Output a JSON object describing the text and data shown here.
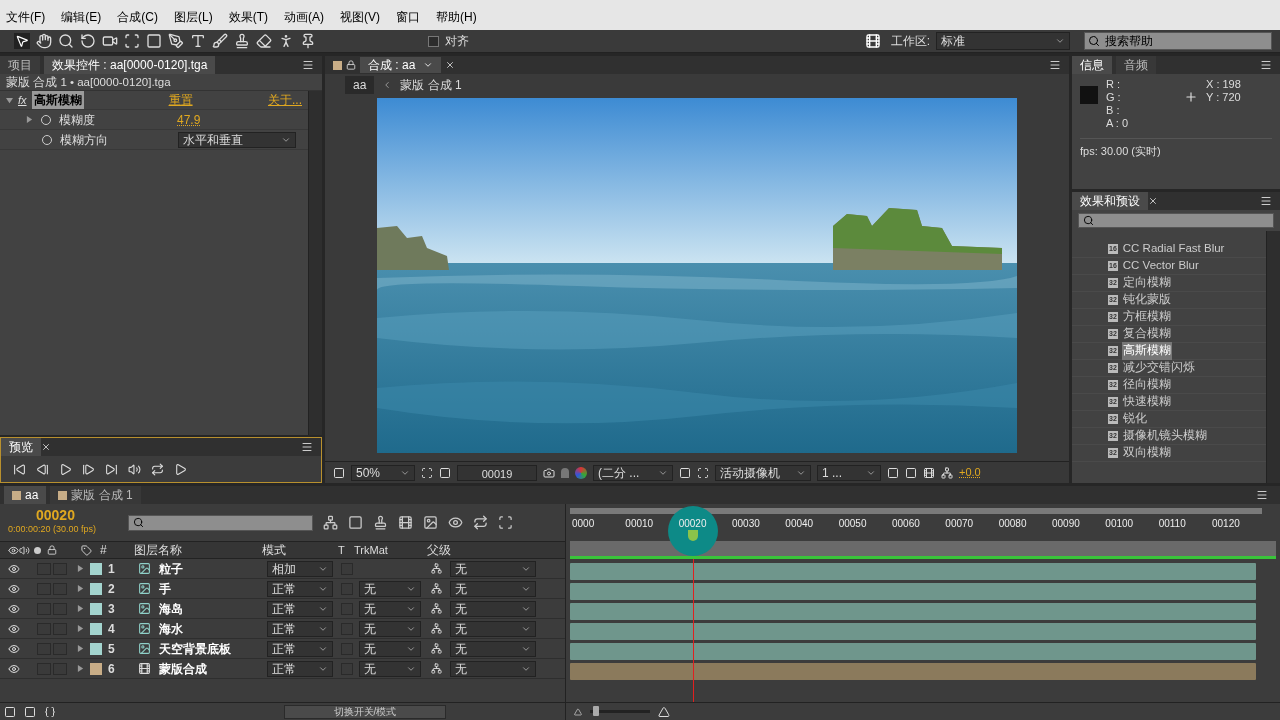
{
  "menu": [
    "文件(F)",
    "编辑(E)",
    "合成(C)",
    "图层(L)",
    "效果(T)",
    "动画(A)",
    "视图(V)",
    "窗口",
    "帮助(H)"
  ],
  "toolbar": {
    "align_label": "对齐",
    "align_checked": false,
    "workspace_label": "工作区:",
    "workspace": "标准",
    "search_placeholder": "搜索帮助"
  },
  "effect_controls": {
    "tabs": [
      {
        "label": "项目",
        "selected": false
      },
      {
        "label": "效果控件 : aa[0000-0120].tga",
        "selected": true
      }
    ],
    "subtitle": "蒙版 合成 1 • aa[0000-0120].tga",
    "effect": {
      "badge": "fx",
      "name": "高斯模糊",
      "expanded": true,
      "reset": "重置",
      "about": "关于..."
    },
    "params": [
      {
        "kind": "value",
        "name": "模糊度",
        "value": "47.9",
        "expanded": false
      },
      {
        "kind": "dropdown",
        "name": "模糊方向",
        "value": "水平和垂直"
      }
    ]
  },
  "preview": {
    "tab": "预览"
  },
  "viewer": {
    "tab": "合成 : aa",
    "breadcrumb": [
      "aa",
      "蒙版 合成 1"
    ],
    "zoom": "50%",
    "frame": "00019",
    "resolution": "(二分 ...",
    "camera": "活动摄像机",
    "views": "1 ...",
    "exposure": "+0.0"
  },
  "info": {
    "tabs": [
      {
        "label": "信息",
        "selected": true
      },
      {
        "label": "音频",
        "selected": false
      }
    ],
    "channels": [
      "R :",
      "G :",
      "B :",
      "A : 0"
    ],
    "coords": [
      "X : 198",
      "Y : 720"
    ],
    "fps": "fps: 30.00 (实时)"
  },
  "effects_presets": {
    "tab": "效果和预设",
    "items": [
      {
        "bits": "16",
        "label": "CC Radial Fast Blur",
        "selected": false
      },
      {
        "bits": "16",
        "label": "CC Vector Blur",
        "selected": false
      },
      {
        "bits": "32",
        "label": "定向模糊",
        "selected": false
      },
      {
        "bits": "32",
        "label": "钝化蒙版",
        "selected": false
      },
      {
        "bits": "32",
        "label": "方框模糊",
        "selected": false
      },
      {
        "bits": "32",
        "label": "复合模糊",
        "selected": false
      },
      {
        "bits": "32",
        "label": "高斯模糊",
        "selected": true
      },
      {
        "bits": "32",
        "label": "减少交错闪烁",
        "selected": false
      },
      {
        "bits": "32",
        "label": "径向模糊",
        "selected": false
      },
      {
        "bits": "32",
        "label": "快速模糊",
        "selected": false
      },
      {
        "bits": "32",
        "label": "锐化",
        "selected": false
      },
      {
        "bits": "32",
        "label": "摄像机镜头模糊",
        "selected": false
      },
      {
        "bits": "32",
        "label": "双向模糊",
        "selected": false
      }
    ]
  },
  "timeline": {
    "tabs": [
      {
        "label": "aa",
        "selected": true,
        "color": "#c8ad87"
      },
      {
        "label": "蒙版 合成 1",
        "selected": false,
        "color": "#c8ad87"
      }
    ],
    "timecode": "00020",
    "timecode_detail": "0:00:00:20 (30.00 fps)",
    "columns": [
      "#",
      "图层名称",
      "模式",
      "T",
      "TrkMat",
      "父级"
    ],
    "ruler": [
      "0000",
      "00010",
      "00020",
      "00030",
      "00040",
      "00050",
      "00060",
      "00070",
      "00080",
      "00090",
      "00100",
      "00110",
      "00120"
    ],
    "playhead": {
      "level": 0.1667
    },
    "zoom": {
      "level": 0.05
    },
    "layers": [
      {
        "kind": "footage",
        "number": "1",
        "name": "粒子",
        "mode": "相加",
        "parent": "无",
        "color": "#a3d4ce"
      },
      {
        "kind": "footage",
        "number": "2",
        "name": "手",
        "mode": "正常",
        "trkmat": "无",
        "parent": "无",
        "color": "#a3d4ce"
      },
      {
        "kind": "footage",
        "number": "3",
        "name": "海岛",
        "mode": "正常",
        "trkmat": "无",
        "parent": "无",
        "color": "#a3d4ce"
      },
      {
        "kind": "footage",
        "number": "4",
        "name": "海水",
        "mode": "正常",
        "trkmat": "无",
        "parent": "无",
        "color": "#a3d4ce"
      },
      {
        "kind": "footage",
        "number": "5",
        "name": "天空背景底板",
        "mode": "正常",
        "trkmat": "无",
        "parent": "无",
        "color": "#a3d4ce"
      },
      {
        "kind": "composition",
        "number": "6",
        "name": "蒙版合成",
        "mode": "正常",
        "trkmat": "无",
        "parent": "无",
        "color": "#c8ad87"
      }
    ],
    "toggle_label": "切换开关/模式"
  }
}
